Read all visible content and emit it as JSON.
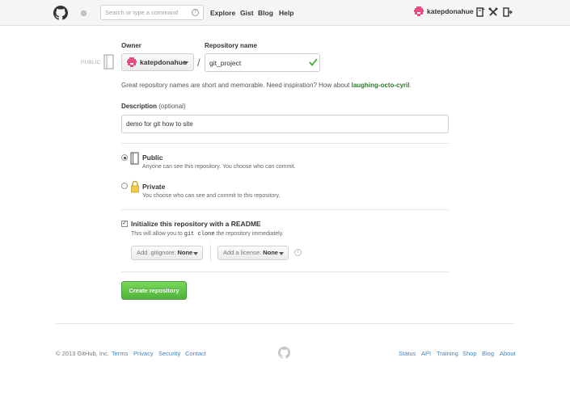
{
  "header": {
    "search_placeholder": "Search or type a command",
    "search_help": "?",
    "nav": [
      "Explore",
      "Gist",
      "Blog",
      "Help"
    ],
    "username": "katepdonahue"
  },
  "form": {
    "owner_label": "Owner",
    "repo_label": "Repository name",
    "visibility_badge": "PUBLIC",
    "owner_value": "katepdonahue",
    "slash": "/",
    "repo_value": "git_project",
    "hint_text": "Great repository names are short and memorable. Need inspiration? How about ",
    "hint_suggestion": "laughing-octo-cyril",
    "hint_end": ".",
    "description_label": "Description",
    "description_optional": "(optional)",
    "description_value": "demo for git how to site",
    "public_title": "Public",
    "public_desc": "Anyone can see this repository. You choose who can commit.",
    "private_title": "Private",
    "private_desc": "You choose who can see and commit to this repository.",
    "init_title": "Initialize this repository with a README",
    "init_desc_pre": "This will allow you to ",
    "init_desc_code": "git clone",
    "init_desc_post": " the repository immediately.",
    "gitignore_label": "Add .gitignore:",
    "gitignore_value": "None",
    "license_label": "Add a license:",
    "license_value": "None",
    "info_glyph": "i",
    "create_button": "Create repository",
    "accent_color": "#4fb23c",
    "success_color": "#2a7a2a",
    "link_color": "#4183c4"
  },
  "footer": {
    "copyright": "© 2013 GitHub, Inc.",
    "links_left": [
      "Terms",
      "Privacy",
      "Security",
      "Contact"
    ],
    "links_right": [
      "Status",
      "API",
      "Training",
      "Shop",
      "Blog",
      "About"
    ]
  }
}
